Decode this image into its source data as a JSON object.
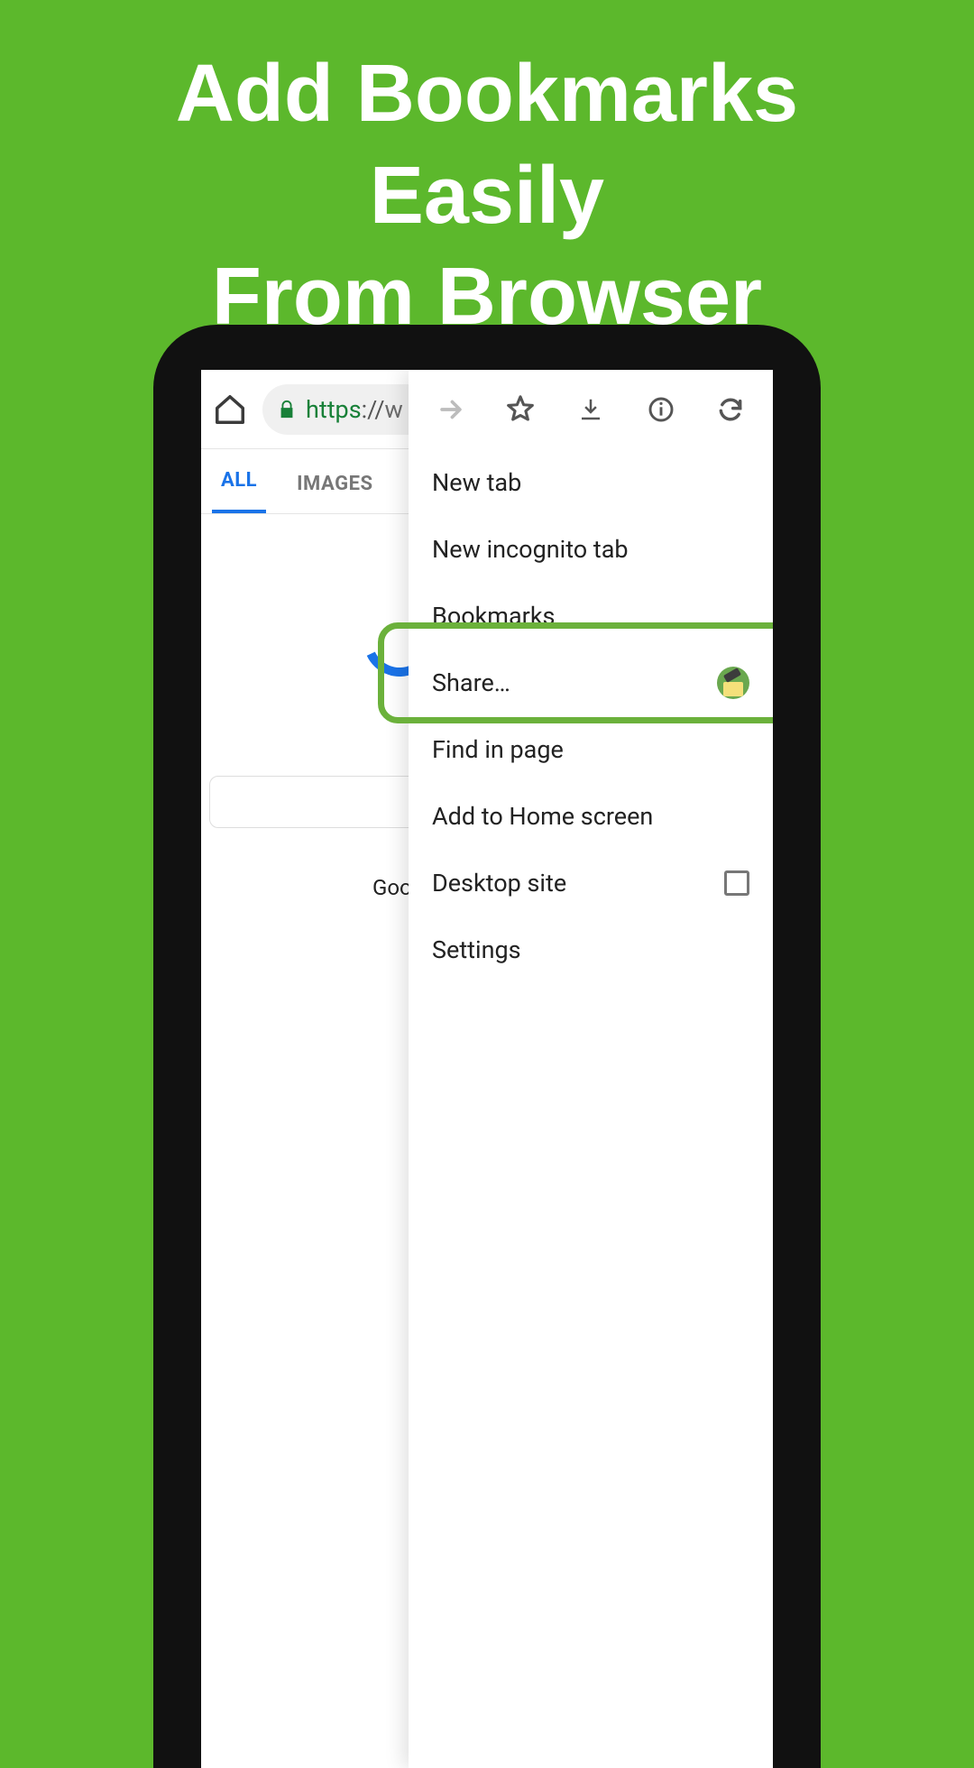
{
  "headline": {
    "line1": "Add Bookmarks",
    "line2": "Easily",
    "line3": "From Browser"
  },
  "toolbar": {
    "url_https": "https",
    "url_sep": "://",
    "url_rest": "w"
  },
  "tabs": {
    "all": "ALL",
    "images": "IMAGES"
  },
  "page": {
    "footer_text": "Goo"
  },
  "menu": {
    "items": {
      "new_tab": "New tab",
      "new_incognito": "New incognito tab",
      "bookmarks": "Bookmarks",
      "share": "Share…",
      "find": "Find in page",
      "add_home": "Add to Home screen",
      "desktop": "Desktop site",
      "settings": "Settings"
    }
  }
}
